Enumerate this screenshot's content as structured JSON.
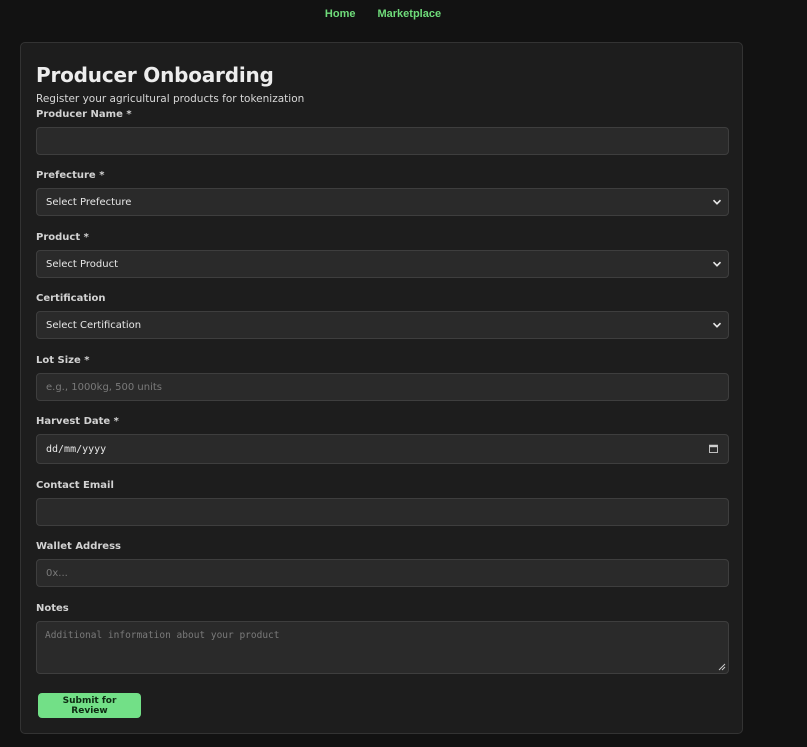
{
  "nav": {
    "home": "Home",
    "marketplace": "Marketplace"
  },
  "form": {
    "title": "Producer Onboarding",
    "subtitle": "Register your agricultural products for tokenization",
    "fields": {
      "producer_name": {
        "label": "Producer Name *",
        "value": ""
      },
      "prefecture": {
        "label": "Prefecture *",
        "selected": "Select Prefecture"
      },
      "product": {
        "label": "Product *",
        "selected": "Select Product"
      },
      "certification": {
        "label": "Certification",
        "selected": "Select Certification"
      },
      "lot_size": {
        "label": "Lot Size *",
        "placeholder": "e.g., 1000kg, 500 units"
      },
      "harvest_date": {
        "label": "Harvest Date *",
        "placeholder": "dd/mm/yyyy"
      },
      "contact_email": {
        "label": "Contact Email",
        "value": ""
      },
      "wallet_address": {
        "label": "Wallet Address",
        "placeholder": "0x..."
      },
      "notes": {
        "label": "Notes",
        "placeholder": "Additional information about your product"
      }
    },
    "submit_label": "Submit for Review"
  },
  "colors": {
    "background": "#121212",
    "card": "#1d1d1d",
    "input": "#2a2a2a",
    "accent": "#6fdc7a",
    "button": "#72e087"
  },
  "icons": {
    "select": "chevron-down-icon",
    "date": "calendar-icon",
    "resize": "resize-handle-icon"
  }
}
